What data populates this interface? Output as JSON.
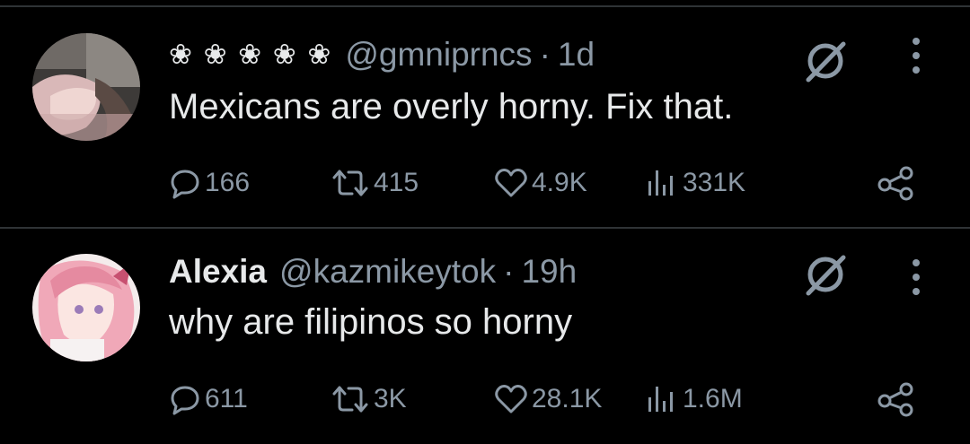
{
  "tweets": [
    {
      "name_decoration": "❀ ❀ ❀ ❀ ❀",
      "handle": "@gmniprncs",
      "separator": "·",
      "time": "1d",
      "text": "Mexicans are overly horny. Fix that.",
      "replies": "166",
      "reposts": "415",
      "likes": "4.9K",
      "views": "331K"
    },
    {
      "name": "Alexia",
      "handle": "@kazmikeytok",
      "separator": "·",
      "time": "19h",
      "text": "why are filipinos so horny",
      "replies": "611",
      "reposts": "3K",
      "likes": "28.1K",
      "views": "1.6M"
    }
  ],
  "colors": {
    "background": "#000000",
    "primary_text": "#e7e9ea",
    "secondary_text": "#8b98a5",
    "divider": "#2f3336"
  },
  "icons": [
    "reply-icon",
    "repost-icon",
    "like-icon",
    "views-icon",
    "share-icon",
    "grok-icon",
    "more-icon"
  ]
}
